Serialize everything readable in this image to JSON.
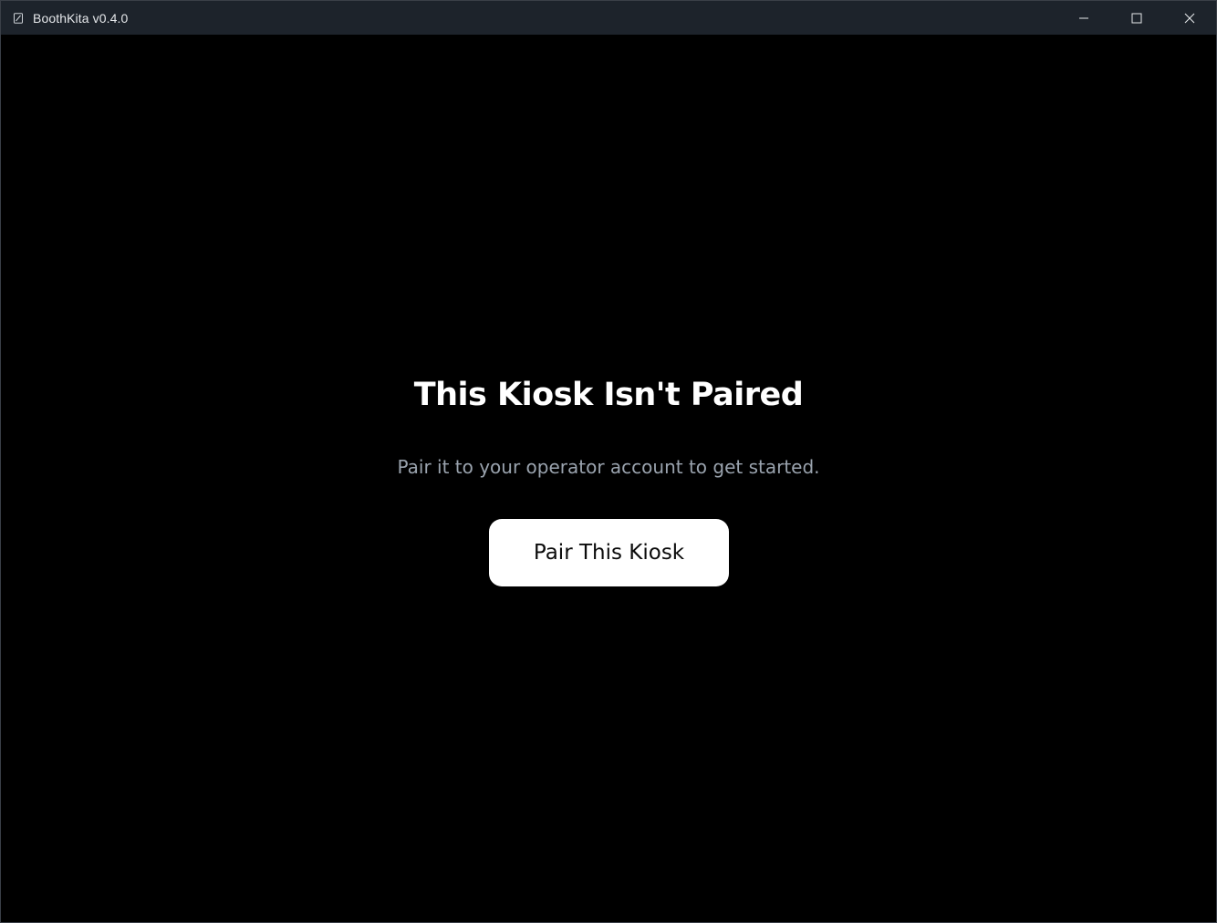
{
  "window": {
    "title": "BoothKita v0.4.0",
    "icons": {
      "app": "app-icon",
      "minimize": "minimize-icon",
      "maximize": "maximize-icon",
      "close": "close-icon"
    }
  },
  "main": {
    "heading": "This Kiosk Isn't Paired",
    "subtitle": "Pair it to your operator account to get started.",
    "pair_button_label": "Pair This Kiosk"
  },
  "colors": {
    "background": "#000000",
    "titlebar": "#1d232b",
    "heading": "#ffffff",
    "subtitle": "#9aa3ae",
    "button_bg": "#ffffff",
    "button_text": "#0b0b0b"
  }
}
